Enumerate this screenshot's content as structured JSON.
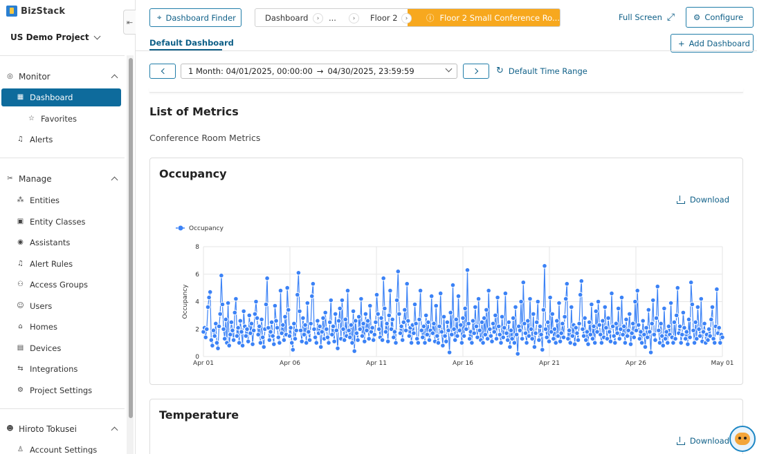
{
  "app": {
    "name": "BizStack",
    "project": "US Demo Project"
  },
  "sidebar": {
    "monitor": {
      "label": "Monitor",
      "items": [
        {
          "label": "Dashboard",
          "icon": "grid-icon"
        },
        {
          "label": "Favorites",
          "icon": "star-icon"
        },
        {
          "label": "Alerts",
          "icon": "bell-icon"
        }
      ]
    },
    "manage": {
      "label": "Manage",
      "items": [
        {
          "label": "Entities",
          "icon": "nodes-icon"
        },
        {
          "label": "Entity Classes",
          "icon": "squares-icon"
        },
        {
          "label": "Assistants",
          "icon": "assistant-icon"
        },
        {
          "label": "Alert Rules",
          "icon": "bell-icon"
        },
        {
          "label": "Access Groups",
          "icon": "group-icon"
        },
        {
          "label": "Users",
          "icon": "users-icon"
        },
        {
          "label": "Homes",
          "icon": "home-icon"
        },
        {
          "label": "Devices",
          "icon": "device-icon"
        },
        {
          "label": "Integrations",
          "icon": "integration-icon"
        },
        {
          "label": "Project Settings",
          "icon": "gear-icon"
        }
      ]
    },
    "account": {
      "label": "Hiroto Tokusei",
      "items": [
        {
          "label": "Account Settings",
          "icon": "user-icon"
        }
      ]
    }
  },
  "toolbar": {
    "dashboard_finder": "Dashboard Finder",
    "breadcrumbs": [
      "Dashboard",
      "...",
      "Floor 2",
      "Floor 2 Small Conference Ro..."
    ],
    "full_screen": "Full Screen",
    "configure": "Configure",
    "add_dashboard": "Add Dashboard",
    "tab": "Default Dashboard"
  },
  "time_range": {
    "value_start": "1 Month: 04/01/2025, 00:00:00",
    "arrow": "→",
    "value_end": "04/30/2025, 23:59:59",
    "default_label": "Default Time Range"
  },
  "content": {
    "heading": "List of Metrics",
    "subheading": "Conference Room Metrics",
    "card1_title": "Occupancy",
    "card2_title": "Temperature",
    "download": "Download"
  },
  "colors": {
    "accent": "#0e6b9c",
    "breadcrumb_active": "#f7a81e",
    "series": "#3b82f6"
  },
  "chart_data": {
    "type": "line",
    "title": "",
    "xlabel": "",
    "ylabel": "Occupancy",
    "ylim": [
      0,
      8
    ],
    "yticks": [
      "0",
      "2",
      "4",
      "6",
      "8"
    ],
    "xticks": [
      "Apr 01",
      "Apr 06",
      "Apr 11",
      "Apr 16",
      "Apr 21",
      "Apr 26",
      "May 01"
    ],
    "x_range": [
      "2025-04-01",
      "2025-05-01"
    ],
    "legend": "top-left",
    "grid": true,
    "series": [
      {
        "name": "Occupancy",
        "color": "#3b82f6",
        "values": [
          1.8,
          2.1,
          1.4,
          2.0,
          3.6,
          4.3,
          4.7,
          1.2,
          0.8,
          1.9,
          1.5,
          2.4,
          1.0,
          0.6,
          2.2,
          3.1,
          5.9,
          3.8,
          2.0,
          1.3,
          2.7,
          1.0,
          3.9,
          0.8,
          1.6,
          2.5,
          1.9,
          1.2,
          3.2,
          4.2,
          1.5,
          2.1,
          1.0,
          2.6,
          1.8,
          0.8,
          3.3,
          2.2,
          1.5,
          2.0,
          1.1,
          3.0,
          1.7,
          2.4,
          0.9,
          1.9,
          3.1,
          4.0,
          2.8,
          1.6,
          2.2,
          1.0,
          2.7,
          1.4,
          0.7,
          2.0,
          3.8,
          5.7,
          2.1,
          1.2,
          1.8,
          2.5,
          1.5,
          0.9,
          3.7,
          2.6,
          2.1,
          1.4,
          1.0,
          4.8,
          1.7,
          2.3,
          1.2,
          2.9,
          1.6,
          5.0,
          3.4,
          1.5,
          2.1,
          1.0,
          0.5,
          2.4,
          1.3,
          1.9,
          4.5,
          6.1,
          3.3,
          1.9,
          1.1,
          2.8,
          1.6,
          2.3,
          1.0,
          3.9,
          1.8,
          1.2,
          2.4,
          4.4,
          5.3,
          2.0,
          1.4,
          1.0,
          2.6,
          1.7,
          2.2,
          0.7,
          1.8,
          2.8,
          1.3,
          3.2,
          2.0,
          1.4,
          1.0,
          2.5,
          4.1,
          1.6,
          2.2,
          1.1,
          3.1,
          1.9,
          0.6,
          2.6,
          3.5,
          1.3,
          4.1,
          2.0,
          1.2,
          2.7,
          1.5,
          4.8,
          1.9,
          1.4,
          2.3,
          1.0,
          3.3,
          0.4,
          2.6,
          1.7,
          1.2,
          2.9,
          2.0,
          4.2,
          1.5,
          2.4,
          1.1,
          3.1,
          1.9,
          2.6,
          1.3,
          3.7,
          1.8,
          2.1,
          1.2,
          1.6,
          2.5,
          4.5,
          3.1,
          2.0,
          1.4,
          2.8,
          1.2,
          5.7,
          3.5,
          1.8,
          2.4,
          1.1,
          3.0,
          4.8,
          2.0,
          2.7,
          1.4,
          1.8,
          1.0,
          4.1,
          6.2,
          3.1,
          1.7,
          2.2,
          1.2,
          2.5,
          3.4,
          1.9,
          5.3,
          2.6,
          1.5,
          2.1,
          1.0,
          2.3,
          1.7,
          3.8,
          2.4,
          1.3,
          1.0,
          2.7,
          4.8,
          1.9,
          1.4,
          2.2,
          1.0,
          3.0,
          1.6,
          2.5,
          1.2,
          1.9,
          4.4,
          1.7,
          2.4,
          1.1,
          3.7,
          1.5,
          1.0,
          2.2,
          4.6,
          1.8,
          0.8,
          2.9,
          1.5,
          1.1,
          2.5,
          1.9,
          0.3,
          3.2,
          1.6,
          5.2,
          2.0,
          1.2,
          2.7,
          1.5,
          4.4,
          1.9,
          2.3,
          1.0,
          2.8,
          1.5,
          3.5,
          2.0,
          6.3,
          2.4,
          1.3,
          1.8,
          1.0,
          2.6,
          1.7,
          3.6,
          2.2,
          1.4,
          4.2,
          1.9,
          1.2,
          2.5,
          1.0,
          2.8,
          1.6,
          3.4,
          1.3,
          4.8,
          2.0,
          1.5,
          1.1,
          2.4,
          1.8,
          3.0,
          1.3,
          4.3,
          2.2,
          1.6,
          1.0,
          2.9,
          1.4,
          2.1,
          4.6,
          1.7,
          1.2,
          2.5,
          0.7,
          1.9,
          1.3,
          2.8,
          1.0,
          3.6,
          1.6,
          0.2,
          2.2,
          1.9,
          4.0,
          1.3,
          5.4,
          2.4,
          1.7,
          1.0,
          2.6,
          1.5,
          4.2,
          2.0,
          1.3,
          3.1,
          0.7,
          1.7,
          2.5,
          4.0,
          1.2,
          2.2,
          1.6,
          0.5,
          3.4,
          6.6,
          2.0,
          1.4,
          2.5,
          1.1,
          4.3,
          1.8,
          3.1,
          1.3,
          2.0,
          1.0,
          2.6,
          1.5,
          3.9,
          1.1,
          1.7,
          2.4,
          1.4,
          2.9,
          4.2,
          5.3,
          1.3,
          1.9,
          1.0,
          3.6,
          1.5,
          2.3,
          0.9,
          2.1,
          1.7,
          1.2,
          2.4,
          4.5,
          5.5,
          2.0,
          1.5,
          2.8,
          1.2,
          1.8,
          0.9,
          2.5,
          1.6,
          3.8,
          1.3,
          2.2,
          1.0,
          3.3,
          1.8,
          4.0,
          2.3,
          1.6,
          1.0,
          2.6,
          1.4,
          3.6,
          2.1,
          1.3,
          2.8,
          1.8,
          1.1,
          4.6,
          2.2,
          1.5,
          1.0,
          2.4,
          1.7,
          3.5,
          1.3,
          2.0,
          4.3,
          1.6,
          2.2,
          1.0,
          2.7,
          1.5,
          1.9,
          3.1,
          0.9,
          1.7,
          2.4,
          1.4,
          4.0,
          1.9,
          4.8,
          2.3,
          1.3,
          1.8,
          1.0,
          2.6,
          1.6,
          0.7,
          2.1,
          1.4,
          3.4,
          1.8,
          0.3,
          2.4,
          4.1,
          1.6,
          1.2,
          2.8,
          5.1,
          1.9,
          1.0,
          2.4,
          1.5,
          0.8,
          3.5,
          1.3,
          1.8,
          1.0,
          2.2,
          1.6,
          3.9,
          1.4,
          1.0,
          2.5,
          1.3,
          3.0,
          5.0,
          1.7,
          2.2,
          1.0,
          1.6,
          3.2,
          2.1,
          1.3,
          1.8,
          0.9,
          2.7,
          1.4,
          5.4,
          3.8,
          1.9,
          1.0,
          2.5,
          1.3,
          3.6,
          2.0,
          1.5,
          4.2,
          1.1,
          1.8,
          2.4,
          1.0,
          1.6,
          1.2,
          2.0,
          1.5,
          2.7,
          3.6,
          1.3,
          1.0,
          2.2,
          4.9,
          1.7,
          2.1,
          1.0,
          1.6,
          1.4
        ]
      }
    ]
  }
}
